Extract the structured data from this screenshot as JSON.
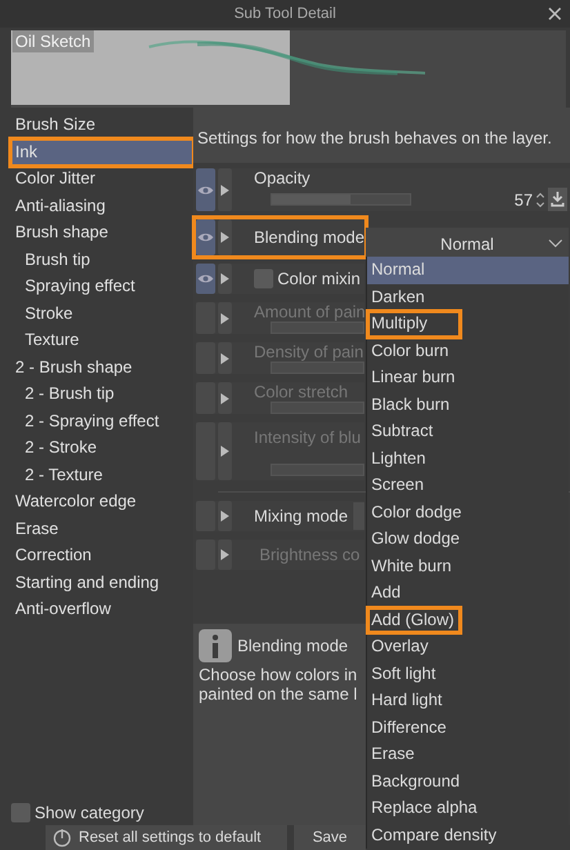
{
  "window": {
    "title": "Sub Tool Detail"
  },
  "preview": {
    "label": "Oil Sketch"
  },
  "sidebar": {
    "items": [
      {
        "label": "Brush Size",
        "selected": false,
        "highlighted": false
      },
      {
        "label": "Ink",
        "selected": true,
        "highlighted": true
      },
      {
        "label": "Color Jitter",
        "selected": false,
        "highlighted": false
      },
      {
        "label": "Anti-aliasing",
        "selected": false,
        "highlighted": false
      },
      {
        "label": "Brush shape",
        "selected": false,
        "highlighted": false,
        "children": [
          {
            "label": "Brush tip",
            "selected": false,
            "highlighted": false
          },
          {
            "label": "Spraying effect",
            "selected": false,
            "highlighted": false
          },
          {
            "label": "Stroke",
            "selected": false,
            "highlighted": false
          },
          {
            "label": "Texture",
            "selected": false,
            "highlighted": false
          }
        ]
      },
      {
        "label": "2 - Brush shape",
        "selected": false,
        "highlighted": false,
        "children": [
          {
            "label": "2 - Brush tip",
            "selected": false,
            "highlighted": false
          },
          {
            "label": "2 - Spraying effect",
            "selected": false,
            "highlighted": false
          },
          {
            "label": "2 - Stroke",
            "selected": false,
            "highlighted": false
          },
          {
            "label": "2 - Texture",
            "selected": false,
            "highlighted": false
          }
        ]
      },
      {
        "label": "Watercolor edge",
        "selected": false,
        "highlighted": false
      },
      {
        "label": "Erase",
        "selected": false,
        "highlighted": false
      },
      {
        "label": "Correction",
        "selected": false,
        "highlighted": false
      },
      {
        "label": "Starting and ending",
        "selected": false,
        "highlighted": false
      },
      {
        "label": "Anti-overflow",
        "selected": false,
        "highlighted": false
      }
    ],
    "show_category": {
      "label": "Show category",
      "checked": false
    }
  },
  "panel": {
    "description": "Settings for how the brush behaves on the layer.",
    "rows": [
      {
        "kind": "slider",
        "label": "Opacity",
        "visible": true,
        "disabled": false,
        "highlighted": false,
        "level": 0.57,
        "value": "57"
      },
      {
        "kind": "dropdown",
        "label": "Blending mode",
        "visible": true,
        "disabled": false,
        "highlighted": true,
        "value": "Normal"
      },
      {
        "kind": "checkbox",
        "label": "Color mixin",
        "visible": true,
        "disabled": false,
        "highlighted": false,
        "checked": false
      },
      {
        "kind": "slider",
        "label": "Amount of pain",
        "visible": false,
        "disabled": true,
        "highlighted": false
      },
      {
        "kind": "slider",
        "label": "Density of pain",
        "visible": false,
        "disabled": true,
        "highlighted": false
      },
      {
        "kind": "slider",
        "label": "Color stretch",
        "visible": false,
        "disabled": true,
        "highlighted": false
      },
      {
        "kind": "tallslider",
        "label": "Intensity of blu",
        "visible": false,
        "disabled": true,
        "highlighted": false
      },
      {
        "kind": "divider"
      },
      {
        "kind": "select",
        "label": "Mixing mode",
        "visible": false,
        "disabled": false,
        "highlighted": false
      },
      {
        "kind": "sub",
        "label": "Brightness co",
        "visible": false,
        "disabled": true,
        "highlighted": false
      }
    ],
    "info": {
      "title": "Blending mode",
      "text": "Choose how colors in\npainted on the same l"
    }
  },
  "dropdown": {
    "items": [
      {
        "label": "Normal",
        "selected": true,
        "highlighted": false
      },
      {
        "label": "Darken",
        "selected": false,
        "highlighted": false
      },
      {
        "label": "Multiply",
        "selected": false,
        "highlighted": true
      },
      {
        "label": "Color burn",
        "selected": false,
        "highlighted": false
      },
      {
        "label": "Linear burn",
        "selected": false,
        "highlighted": false
      },
      {
        "label": "Black burn",
        "selected": false,
        "highlighted": false
      },
      {
        "label": "Subtract",
        "selected": false,
        "highlighted": false
      },
      {
        "label": "Lighten",
        "selected": false,
        "highlighted": false
      },
      {
        "label": "Screen",
        "selected": false,
        "highlighted": false
      },
      {
        "label": "Color dodge",
        "selected": false,
        "highlighted": false
      },
      {
        "label": "Glow dodge",
        "selected": false,
        "highlighted": false
      },
      {
        "label": "White burn",
        "selected": false,
        "highlighted": false
      },
      {
        "label": "Add",
        "selected": false,
        "highlighted": false
      },
      {
        "label": "Add (Glow)",
        "selected": false,
        "highlighted": true
      },
      {
        "label": "Overlay",
        "selected": false,
        "highlighted": false
      },
      {
        "label": "Soft light",
        "selected": false,
        "highlighted": false
      },
      {
        "label": "Hard light",
        "selected": false,
        "highlighted": false
      },
      {
        "label": "Difference",
        "selected": false,
        "highlighted": false
      },
      {
        "label": "Erase",
        "selected": false,
        "highlighted": false
      },
      {
        "label": "Background",
        "selected": false,
        "highlighted": false
      },
      {
        "label": "Replace alpha",
        "selected": false,
        "highlighted": false
      },
      {
        "label": "Compare density",
        "selected": false,
        "highlighted": false
      }
    ]
  },
  "buttons": [
    {
      "label": "Reset all settings to default",
      "kind": "reset"
    },
    {
      "label": "Save",
      "kind": "plain"
    }
  ]
}
